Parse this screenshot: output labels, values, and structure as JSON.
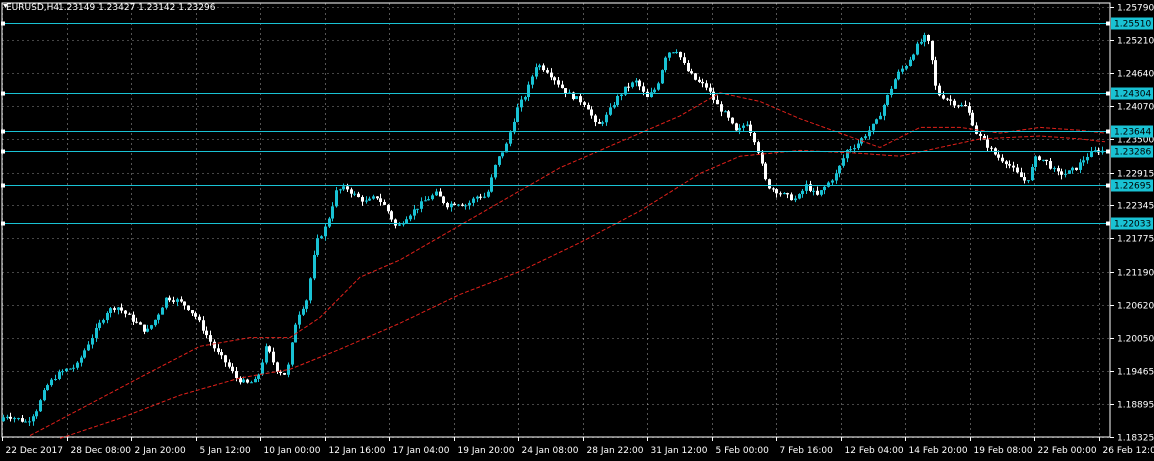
{
  "header": {
    "symbol": "EURUSD,H4",
    "ohlc": "1.23149 1.23427 1.23142 1.23296"
  },
  "colors": {
    "background": "#000000",
    "grid": "#ffffff",
    "bull": "#19c2d4",
    "bear": "#ffffff",
    "ma": "#e0201a",
    "hline": "#19c2d4",
    "label_bg": "#19c2d4"
  },
  "chart_data": {
    "type": "candlestick",
    "title": "",
    "xlabel": "",
    "ylabel": "",
    "ylim": [
      1.18325,
      1.2579
    ],
    "grid": true,
    "y_ticks": [
      "1.25790",
      "1.25210",
      "1.24640",
      "1.24070",
      "1.23500",
      "1.22915",
      "1.22345",
      "1.21775",
      "1.21190",
      "1.20620",
      "1.20050",
      "1.19465",
      "1.18895",
      "1.18325"
    ],
    "x_ticks": [
      "22 Dec 2017",
      "28 Dec 08:00",
      "2 Jan 20:00",
      "5 Jan 12:00",
      "10 Jan 00:00",
      "12 Jan 16:00",
      "17 Jan 04:00",
      "19 Jan 20:00",
      "24 Jan 08:00",
      "28 Jan 22:00",
      "31 Jan 12:00",
      "5 Feb 00:00",
      "7 Feb 16:00",
      "12 Feb 04:00",
      "14 Feb 20:00",
      "19 Feb 08:00",
      "22 Feb 00:00",
      "26 Feb 12:00"
    ],
    "horizontal_lines": [
      "1.25510",
      "1.24304",
      "1.23644",
      "1.23286",
      "1.22695",
      "1.22033"
    ],
    "price_path": [
      [
        0,
        1.186
      ],
      [
        10,
        1.187
      ],
      [
        20,
        1.1865
      ],
      [
        30,
        1.1858
      ],
      [
        40,
        1.188
      ],
      [
        50,
        1.192
      ],
      [
        60,
        1.194
      ],
      [
        70,
        1.195
      ],
      [
        80,
        1.1955
      ],
      [
        90,
        1.199
      ],
      [
        100,
        1.202
      ],
      [
        110,
        1.205
      ],
      [
        120,
        1.206
      ],
      [
        130,
        1.2045
      ],
      [
        140,
        1.203
      ],
      [
        150,
        1.2015
      ],
      [
        160,
        1.204
      ],
      [
        170,
        1.2075
      ],
      [
        180,
        1.207
      ],
      [
        190,
        1.206
      ],
      [
        200,
        1.204
      ],
      [
        210,
        1.201
      ],
      [
        220,
        1.198
      ],
      [
        230,
        1.196
      ],
      [
        240,
        1.1935
      ],
      [
        250,
        1.1925
      ],
      [
        260,
        1.193
      ],
      [
        270,
        1.199
      ],
      [
        280,
        1.195
      ],
      [
        290,
        1.194
      ],
      [
        300,
        1.204
      ],
      [
        310,
        1.207
      ],
      [
        320,
        1.217
      ],
      [
        330,
        1.22
      ],
      [
        340,
        1.226
      ],
      [
        350,
        1.2265
      ],
      [
        360,
        1.225
      ],
      [
        370,
        1.224
      ],
      [
        380,
        1.225
      ],
      [
        390,
        1.223
      ],
      [
        400,
        1.2195
      ],
      [
        410,
        1.2215
      ],
      [
        420,
        1.223
      ],
      [
        430,
        1.2245
      ],
      [
        440,
        1.2255
      ],
      [
        450,
        1.2235
      ],
      [
        460,
        1.224
      ],
      [
        470,
        1.2235
      ],
      [
        480,
        1.225
      ],
      [
        490,
        1.225
      ],
      [
        500,
        1.231
      ],
      [
        510,
        1.234
      ],
      [
        520,
        1.24
      ],
      [
        530,
        1.243
      ],
      [
        540,
        1.248
      ],
      [
        550,
        1.247
      ],
      [
        560,
        1.245
      ],
      [
        570,
        1.243
      ],
      [
        580,
        1.242
      ],
      [
        590,
        1.241
      ],
      [
        600,
        1.237
      ],
      [
        610,
        1.239
      ],
      [
        620,
        1.242
      ],
      [
        630,
        1.244
      ],
      [
        640,
        1.245
      ],
      [
        650,
        1.242
      ],
      [
        660,
        1.244
      ],
      [
        670,
        1.25
      ],
      [
        680,
        1.2505
      ],
      [
        690,
        1.247
      ],
      [
        700,
        1.245
      ],
      [
        710,
        1.244
      ],
      [
        720,
        1.241
      ],
      [
        730,
        1.239
      ],
      [
        740,
        1.236
      ],
      [
        750,
        1.238
      ],
      [
        760,
        1.234
      ],
      [
        770,
        1.227
      ],
      [
        780,
        1.226
      ],
      [
        790,
        1.225
      ],
      [
        800,
        1.2245
      ],
      [
        810,
        1.227
      ],
      [
        820,
        1.225
      ],
      [
        830,
        1.227
      ],
      [
        840,
        1.229
      ],
      [
        850,
        1.233
      ],
      [
        860,
        1.234
      ],
      [
        870,
        1.236
      ],
      [
        880,
        1.238
      ],
      [
        890,
        1.242
      ],
      [
        900,
        1.246
      ],
      [
        910,
        1.248
      ],
      [
        920,
        1.251
      ],
      [
        930,
        1.253
      ],
      [
        935,
        1.249
      ],
      [
        940,
        1.243
      ],
      [
        950,
        1.242
      ],
      [
        960,
        1.241
      ],
      [
        970,
        1.2405
      ],
      [
        980,
        1.236
      ],
      [
        990,
        1.234
      ],
      [
        1000,
        1.232
      ],
      [
        1010,
        1.231
      ],
      [
        1020,
        1.229
      ],
      [
        1030,
        1.2275
      ],
      [
        1040,
        1.232
      ],
      [
        1050,
        1.231
      ],
      [
        1060,
        1.229
      ],
      [
        1070,
        1.229
      ],
      [
        1080,
        1.23
      ],
      [
        1090,
        1.232
      ],
      [
        1100,
        1.233
      ],
      [
        1105,
        1.2329
      ]
    ],
    "ma_fast_path": [
      [
        30,
        1.1835
      ],
      [
        90,
        1.189
      ],
      [
        150,
        1.1945
      ],
      [
        200,
        1.199
      ],
      [
        250,
        1.2005
      ],
      [
        290,
        1.2005
      ],
      [
        320,
        1.204
      ],
      [
        360,
        1.211
      ],
      [
        400,
        1.214
      ],
      [
        440,
        1.218
      ],
      [
        480,
        1.222
      ],
      [
        510,
        1.225
      ],
      [
        560,
        1.23
      ],
      [
        620,
        1.2345
      ],
      [
        680,
        1.239
      ],
      [
        720,
        1.243
      ],
      [
        760,
        1.2415
      ],
      [
        800,
        1.2385
      ],
      [
        840,
        1.236
      ],
      [
        880,
        1.2335
      ],
      [
        920,
        1.237
      ],
      [
        960,
        1.237
      ],
      [
        1000,
        1.236
      ],
      [
        1040,
        1.237
      ],
      [
        1080,
        1.2365
      ],
      [
        1105,
        1.236
      ]
    ],
    "ma_slow_path": [
      [
        60,
        1.183
      ],
      [
        120,
        1.1865
      ],
      [
        180,
        1.1905
      ],
      [
        240,
        1.1935
      ],
      [
        290,
        1.195
      ],
      [
        340,
        1.1985
      ],
      [
        400,
        1.203
      ],
      [
        460,
        1.208
      ],
      [
        520,
        1.212
      ],
      [
        580,
        1.217
      ],
      [
        640,
        1.2225
      ],
      [
        700,
        1.229
      ],
      [
        740,
        1.232
      ],
      [
        800,
        1.233
      ],
      [
        860,
        1.2325
      ],
      [
        900,
        1.232
      ],
      [
        940,
        1.2335
      ],
      [
        980,
        1.235
      ],
      [
        1040,
        1.2355
      ],
      [
        1080,
        1.235
      ],
      [
        1105,
        1.2345
      ]
    ]
  }
}
